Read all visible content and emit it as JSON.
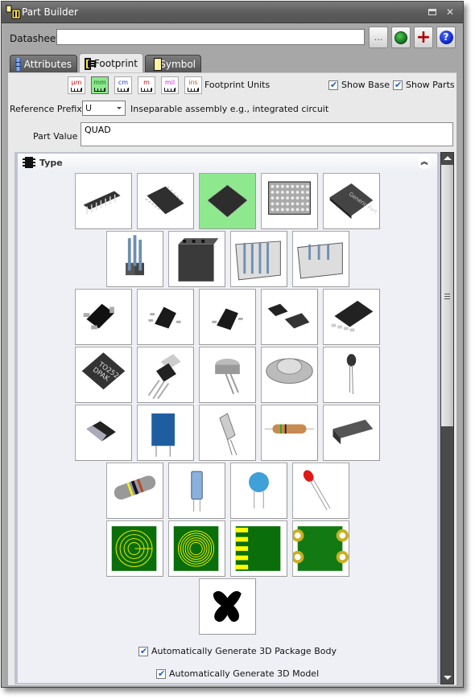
{
  "window": {
    "title": "Part Builder",
    "maximize_icon": "maximize-icon",
    "close_icon": "close-icon",
    "close_glyph": "✕"
  },
  "header": {
    "datasheet_label": "Datasheet",
    "datasheet_value": "",
    "browse_label": "...",
    "web_icon": "globe-icon",
    "add_icon": "plus-icon",
    "add_glyph": "+",
    "help_icon": "help-icon",
    "help_glyph": "?"
  },
  "tabs": [
    {
      "label": "Attributes",
      "icon": "database-icon",
      "active": false
    },
    {
      "label": "Footprint",
      "icon": "footprint-icon",
      "active": true
    },
    {
      "label": "Symbol",
      "icon": "symbol-icon",
      "active": false
    }
  ],
  "footprint": {
    "units": [
      {
        "label": "µm",
        "color": "#d01010",
        "active": false
      },
      {
        "label": "mm",
        "color": "#107010",
        "active": true
      },
      {
        "label": "cm",
        "color": "#2040c0",
        "active": false
      },
      {
        "label": "m",
        "color": "#c01010",
        "active": false
      },
      {
        "label": "mil",
        "color": "#e020e0",
        "active": false
      },
      {
        "label": "ins",
        "color": "#b06020",
        "active": false
      }
    ],
    "units_label": "Footprint Units",
    "show_base": {
      "label": "Show Base",
      "checked": true
    },
    "show_parts": {
      "label": "Show Parts",
      "checked": true
    },
    "reference_prefix_label": "Reference Prefix",
    "reference_prefix_value": "U",
    "reference_prefix_hint": "Inseparable assembly e.g., integrated circuit",
    "part_value_label": "Part Value",
    "part_value": "QUAD"
  },
  "type_section": {
    "title": "Type",
    "collapse_glyph": "︽",
    "selected_index": 2,
    "rows": [
      [
        "DIP",
        "SOIC",
        "QFP",
        "BGA",
        "Generic Part"
      ],
      [
        "Pin Header",
        "Socket Header",
        "Shrouded Header",
        "Wire-to-Board Header"
      ],
      [
        "SOT-23",
        "SOT-23-5",
        "SC-70",
        "SOT-89",
        "SOT-223"
      ],
      [
        "TO252 DPAK",
        "TO-220",
        "TO-39 Can",
        "TO-3",
        "TO-92"
      ],
      [
        "Chip",
        "Film Capacitor",
        "Crystal",
        "Axial Resistor",
        "Molded Diode"
      ],
      [
        "MELF",
        "Electrolytic Capacitor",
        "Ceramic Disc Capacitor",
        "LED"
      ],
      [
        "Spiral Inductor",
        "Round Spiral Inductor",
        "Edge Connector",
        "Pad Array"
      ],
      [
        "None"
      ]
    ],
    "generic_part_text": "Generic Part",
    "dpak_text_1": "TO252",
    "dpak_text_2": "DPAK",
    "auto_body": {
      "label": "Automatically Generate 3D Package Body",
      "checked": true
    },
    "auto_model": {
      "label": "Automatically Generate 3D Model",
      "checked": true
    }
  }
}
